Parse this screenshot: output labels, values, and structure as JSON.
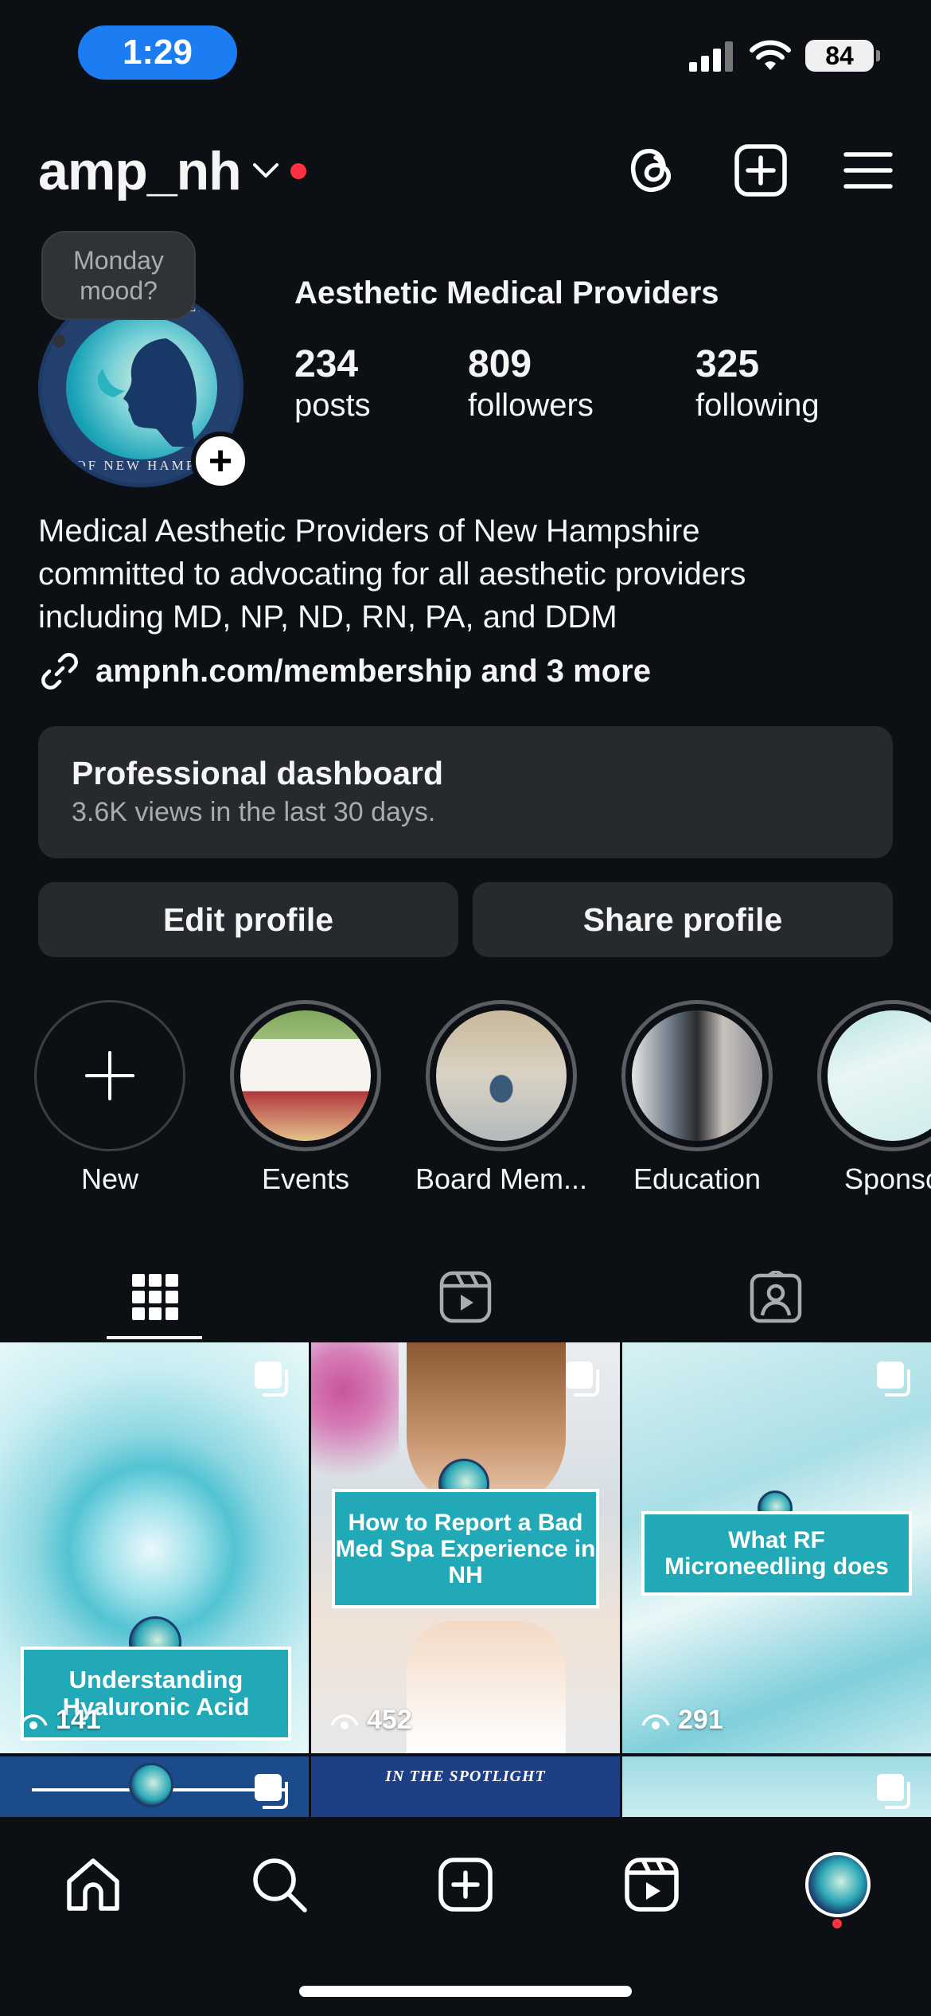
{
  "status_bar": {
    "time": "1:29",
    "battery": "84"
  },
  "header": {
    "username": "amp_nh"
  },
  "note": {
    "text": "Monday mood?"
  },
  "avatar": {
    "ring_text_top": "AESTH        ROVIDERS",
    "ring_text_bottom": "OF NEW HAMPS"
  },
  "profile": {
    "display_name": "Aesthetic Medical Providers",
    "stats": [
      {
        "num": "234",
        "label": "posts"
      },
      {
        "num": "809",
        "label": "followers"
      },
      {
        "num": "325",
        "label": "following"
      }
    ],
    "bio": [
      "Medical Aesthetic Providers of New Hampshire",
      "committed to advocating for all aesthetic providers",
      "including MD, NP, ND, RN, PA, and DDM"
    ],
    "link": "ampnh.com/membership and 3 more"
  },
  "dashboard": {
    "title": "Professional dashboard",
    "subtitle": "3.6K views in the last 30 days."
  },
  "buttons": {
    "edit": "Edit profile",
    "share": "Share profile"
  },
  "highlights": [
    {
      "label": "New"
    },
    {
      "label": "Events"
    },
    {
      "label": "Board Mem..."
    },
    {
      "label": "Education"
    },
    {
      "label": "Sponso"
    }
  ],
  "posts": [
    {
      "title": "Understanding Hyaluronic Acid",
      "views": "141"
    },
    {
      "title": "How to Report a Bad Med Spa Experience in NH",
      "views": "452"
    },
    {
      "title": "What RF Microneedling does",
      "views": "291"
    },
    {
      "title": "",
      "views": ""
    },
    {
      "title": "IN THE SPOTLIGHT",
      "views": ""
    },
    {
      "title": "",
      "views": ""
    }
  ],
  "colors": {
    "background": "#0c1014",
    "card": "#262a2f",
    "accent_teal": "#21a9b8",
    "notify_red": "#ff3040",
    "status_pill": "#1c7cf2"
  }
}
